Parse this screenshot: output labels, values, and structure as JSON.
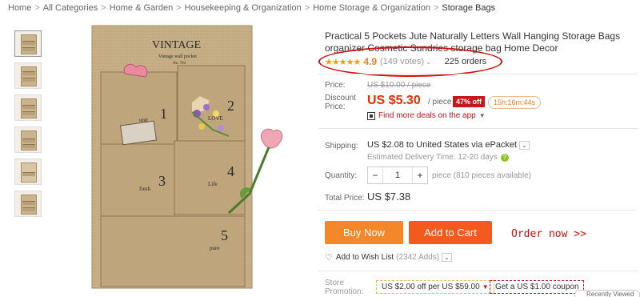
{
  "breadcrumb": {
    "items": [
      "Home",
      "All Categories",
      "Home & Garden",
      "Housekeeping & Organization",
      "Home Storage & Organization",
      "Storage Bags"
    ],
    "separator": ">"
  },
  "gallery": {
    "thumbnails": [
      "thumb-1",
      "thumb-2",
      "thumb-3",
      "thumb-4",
      "thumb-5",
      "thumb-6"
    ],
    "image_text": {
      "brand": "VINTAGE",
      "subtitle": "Vintage wall pocket",
      "code": "No. 703",
      "pocket_labels": [
        "1",
        "2",
        "3",
        "4",
        "5"
      ],
      "pocket_words": [
        "unit",
        "LOVE",
        "fresh",
        "Life",
        "pure"
      ]
    }
  },
  "product": {
    "title": "Practical 5 Pockets Jute Naturally Letters Wall Hanging Storage Bags organizer Cosmetic Sundries storage bag Home Decor",
    "rating": {
      "stars": "★★★★★",
      "score": "4.9",
      "votes": "(149 votes)",
      "caret": "⌄",
      "orders": "225 orders"
    },
    "price": {
      "label": "Price:",
      "old": "US $10.00 / piece",
      "discount_label": "Discount Price:",
      "discount_label_line1": "Discount",
      "discount_label_line2": "Price:",
      "current": "US $5.30",
      "per_piece": "/ piece",
      "badge": "47% off",
      "countdown": "15h:16m:44s",
      "deals_link": "Find more deals on the app",
      "deals_caret": "▼"
    },
    "shipping": {
      "label": "Shipping:",
      "value": "US $2.08 to United States via ePacket",
      "caret": "⌄",
      "delivery": "Estimated Delivery Time: 12-20 days",
      "help": "?"
    },
    "quantity": {
      "label": "Quantity:",
      "minus": "−",
      "value": "1",
      "plus": "+",
      "info": "piece (810 pieces available)"
    },
    "total": {
      "label": "Total Price:",
      "value": "US $7.38"
    },
    "actions": {
      "buy_now": "Buy Now",
      "add_to_cart": "Add to Cart",
      "annotation": "Order now >>"
    },
    "wishlist": {
      "label": "Add to Wish List",
      "count": "(2342 Adds)",
      "caret": "⌄"
    },
    "promotion": {
      "label_line1": "Store",
      "label_line2": "Promotion:",
      "coupon1": "US $2.00 off per US $59.00",
      "coupon1_caret": "▼",
      "coupon2": "Get a US $1.00 coupon"
    },
    "recently_viewed": "Recently Viewed"
  },
  "colors": {
    "accent_red": "#e62e04",
    "buy_now_orange": "#f4872a",
    "add_to_cart_orange": "#f45a1e",
    "annotation_red": "#d10f0f",
    "star_orange": "#ff9900"
  }
}
